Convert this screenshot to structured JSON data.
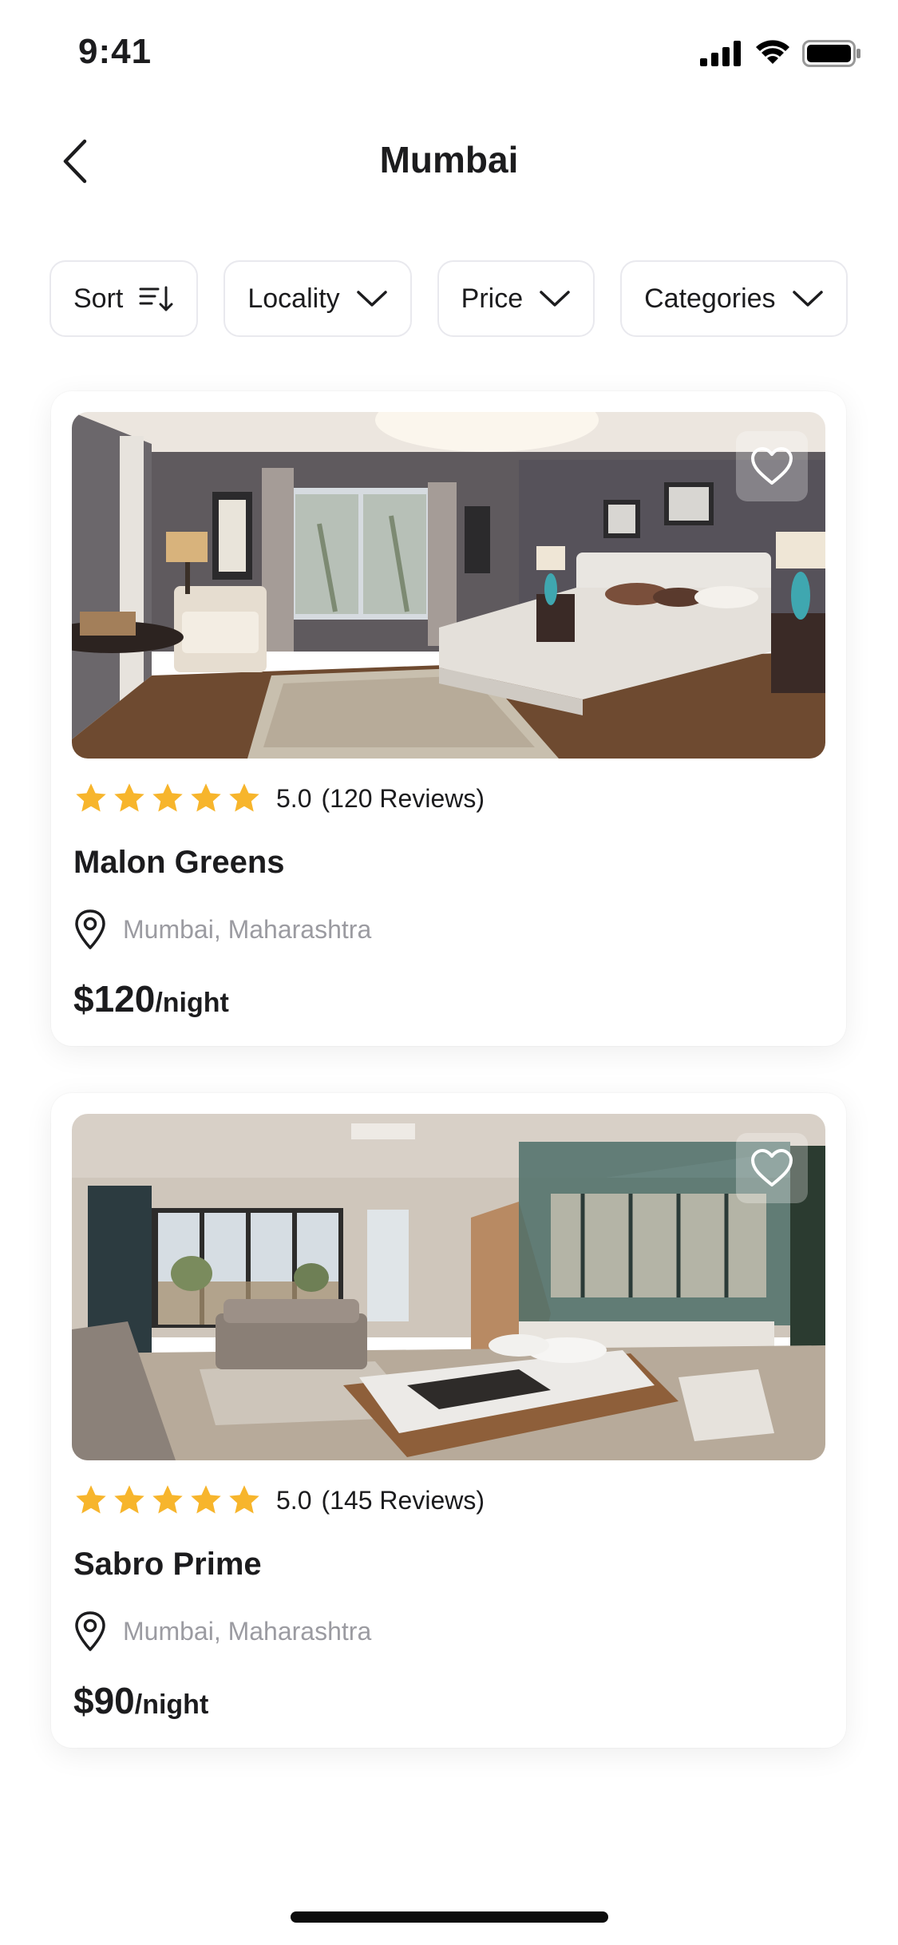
{
  "status_bar": {
    "time": "9:41"
  },
  "header": {
    "title": "Mumbai"
  },
  "filters": [
    {
      "label": "Sort",
      "icon": "sort-icon"
    },
    {
      "label": "Locality",
      "icon": "chevron-down-icon"
    },
    {
      "label": "Price",
      "icon": "chevron-down-icon"
    },
    {
      "label": "Categories",
      "icon": "chevron-down-icon"
    }
  ],
  "listings": [
    {
      "name": "Malon Greens",
      "rating": "5.0",
      "reviews": "(120 Reviews)",
      "stars": 5,
      "location": "Mumbai, Maharashtra",
      "price": "$120",
      "price_unit": "/night",
      "favorited": false
    },
    {
      "name": "Sabro Prime",
      "rating": "5.0",
      "reviews": "(145 Reviews)",
      "stars": 5,
      "location": "Mumbai, Maharashtra",
      "price": "$90",
      "price_unit": "/night",
      "favorited": false
    }
  ],
  "colors": {
    "star": "#f7b52c",
    "text_primary": "#1c1c1e",
    "text_secondary": "#9b9ba1",
    "chip_border": "#e9e9ee"
  }
}
